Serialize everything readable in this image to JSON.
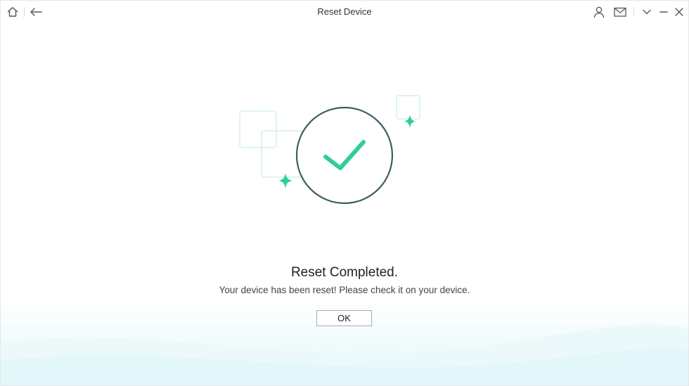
{
  "window": {
    "title": "Reset Device"
  },
  "titlebar": {
    "left_icons": [
      "home-icon",
      "back-arrow-icon"
    ],
    "right_icons": [
      "user-icon",
      "mail-icon",
      "chevron-down-icon",
      "minimize-icon",
      "close-icon"
    ]
  },
  "main": {
    "heading": "Reset Completed.",
    "message": "Your device has been reset! Please check it on your device.",
    "ok_label": "OK"
  },
  "colors": {
    "accent_green": "#2fcf94",
    "circle_stroke": "#3d5e62",
    "frame_stroke": "#bfe9e0",
    "bottom_tint": "#e6f7fb"
  }
}
